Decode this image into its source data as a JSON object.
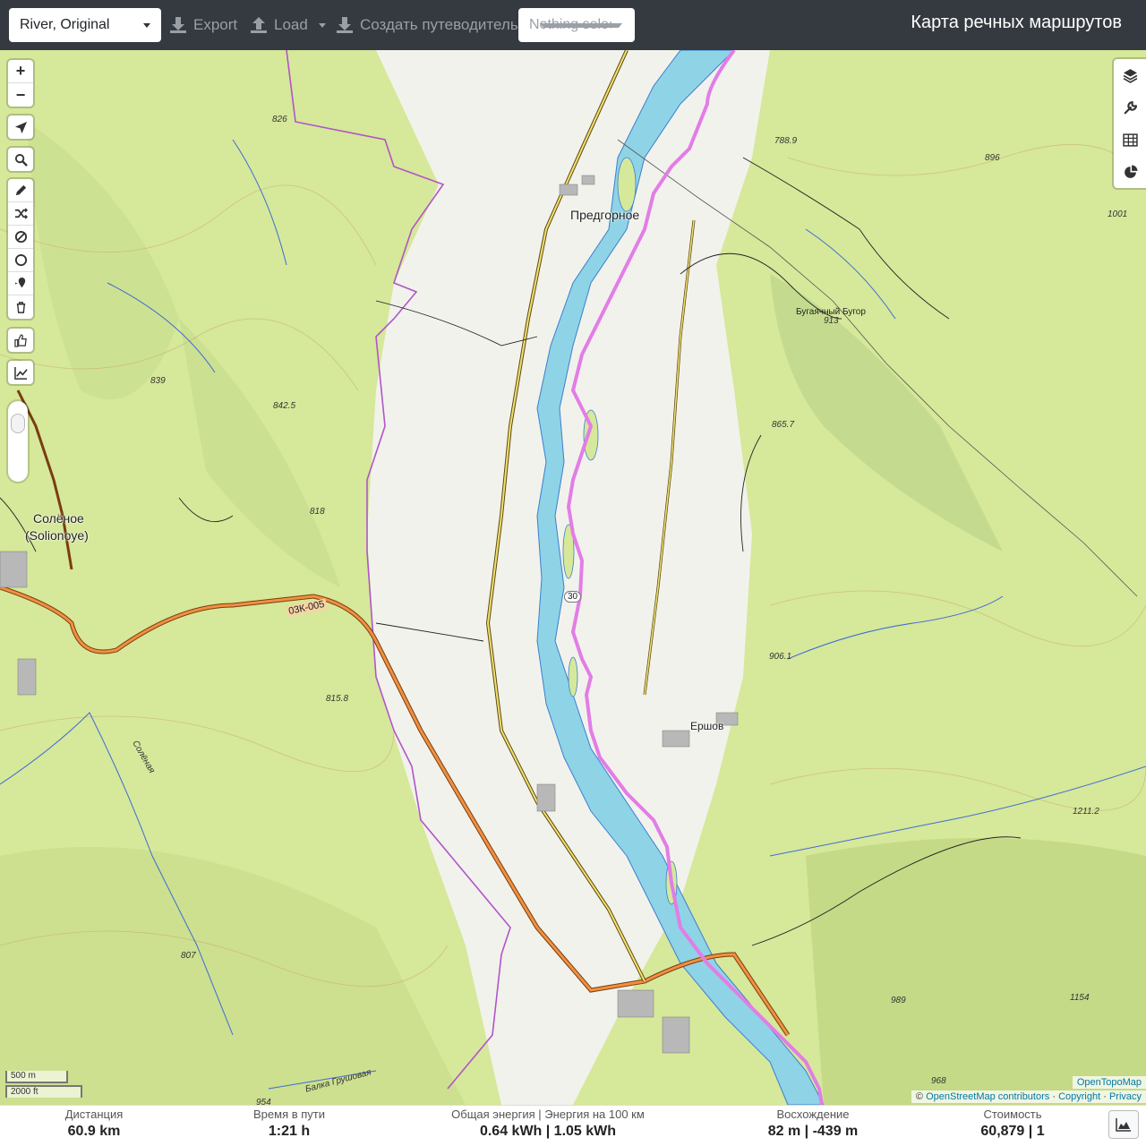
{
  "navbar": {
    "profile_select": "River, Original",
    "export_label": "Export",
    "load_label": "Load",
    "guide_label": "Создать путеводитель",
    "nothing_selected": "Nothing selected",
    "brand": "Карта речных маршрутов"
  },
  "map": {
    "labels": {
      "town_predgornoe": "Предгорное",
      "town_solenoe": "Солёное",
      "town_solenoe_latin": "(Solionoye)",
      "town_ershov": "Ершов",
      "road_03k005": "03К-005",
      "road_30": "30",
      "hill_bugayachny": "Бугаячный Бугор",
      "river_solenaya": "Солёная",
      "river_grushovaya": "Балка Грушовая"
    },
    "elevations": {
      "e826": "826",
      "e788": "788.9",
      "e896": "896",
      "e1001": "1001",
      "e913": "913",
      "e839": "839",
      "e842": "842.5",
      "e865": "865.7",
      "e818": "818",
      "e906": "906.1",
      "e815": "815.8",
      "e1211": "1211.2",
      "e807": "807",
      "e989": "989",
      "e1154": "1154",
      "e968": "968",
      "e954": "954"
    },
    "scale_m": "500 m",
    "scale_ft": "2000 ft",
    "attr_provider": "OpenTopoMap",
    "attr_osm": "OpenStreetMap contributors",
    "attr_copyright": "Copyright",
    "attr_privacy": "Privacy",
    "attr_prefix": "©",
    "attr_sep": "·"
  },
  "controls": {
    "zoom_in": "+",
    "zoom_out": "−"
  },
  "stats": {
    "distance_label": "Дистанция",
    "distance_value": "60.9 km",
    "time_label": "Время в пути",
    "time_value": "1:21 h",
    "energy_label": "Общая энергия | Энергия на 100 км",
    "energy_value": "0.64 kWh | 1.05 kWh",
    "ascent_label": "Восхождение",
    "ascent_value": "82 m | -439 m",
    "cost_label": "Стоимость",
    "cost_value": "60,879 | 1"
  },
  "colors": {
    "navbar_bg": "#343a40",
    "route": "#e27de6",
    "river": "#8fd3e6",
    "terrain": "#d6e89a",
    "valley": "#f2f2ec"
  }
}
